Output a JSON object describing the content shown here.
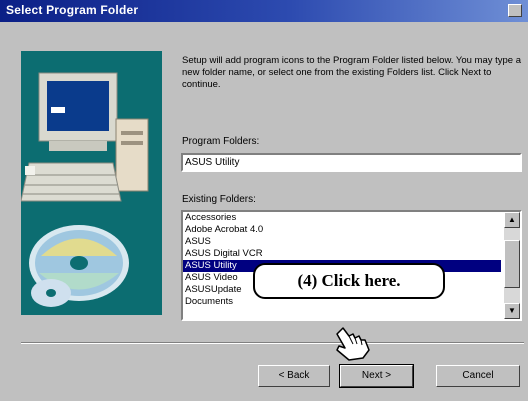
{
  "window": {
    "title": "Select Program Folder"
  },
  "description": "Setup will add program icons to the Program Folder listed below. You may type a new folder name, or select one from the existing Folders list. Click Next to continue.",
  "program_folder": {
    "label": "Program Folders:",
    "value": "ASUS Utility"
  },
  "existing_folders": {
    "label": "Existing Folders:",
    "items": [
      "Accessories",
      "Adobe Acrobat 4.0",
      "ASUS",
      "ASUS Digital VCR",
      "ASUS Utility",
      "ASUS Video",
      "ASUSUpdate",
      "Documents"
    ],
    "selected_index": 4
  },
  "buttons": {
    "back": "< Back",
    "next": "Next >",
    "cancel": "Cancel"
  },
  "callout": {
    "text": "(4)  Click here."
  },
  "colors": {
    "titlebar": "#0b1f86",
    "selection": "#000080",
    "dialog": "#c0c0c0",
    "illustration_bg": "#0c6d71"
  },
  "icons": [
    "computer-illustration-icon",
    "cd-disc-icon",
    "pointing-hand-icon",
    "scroll-up-arrow-icon",
    "scroll-down-arrow-icon"
  ]
}
